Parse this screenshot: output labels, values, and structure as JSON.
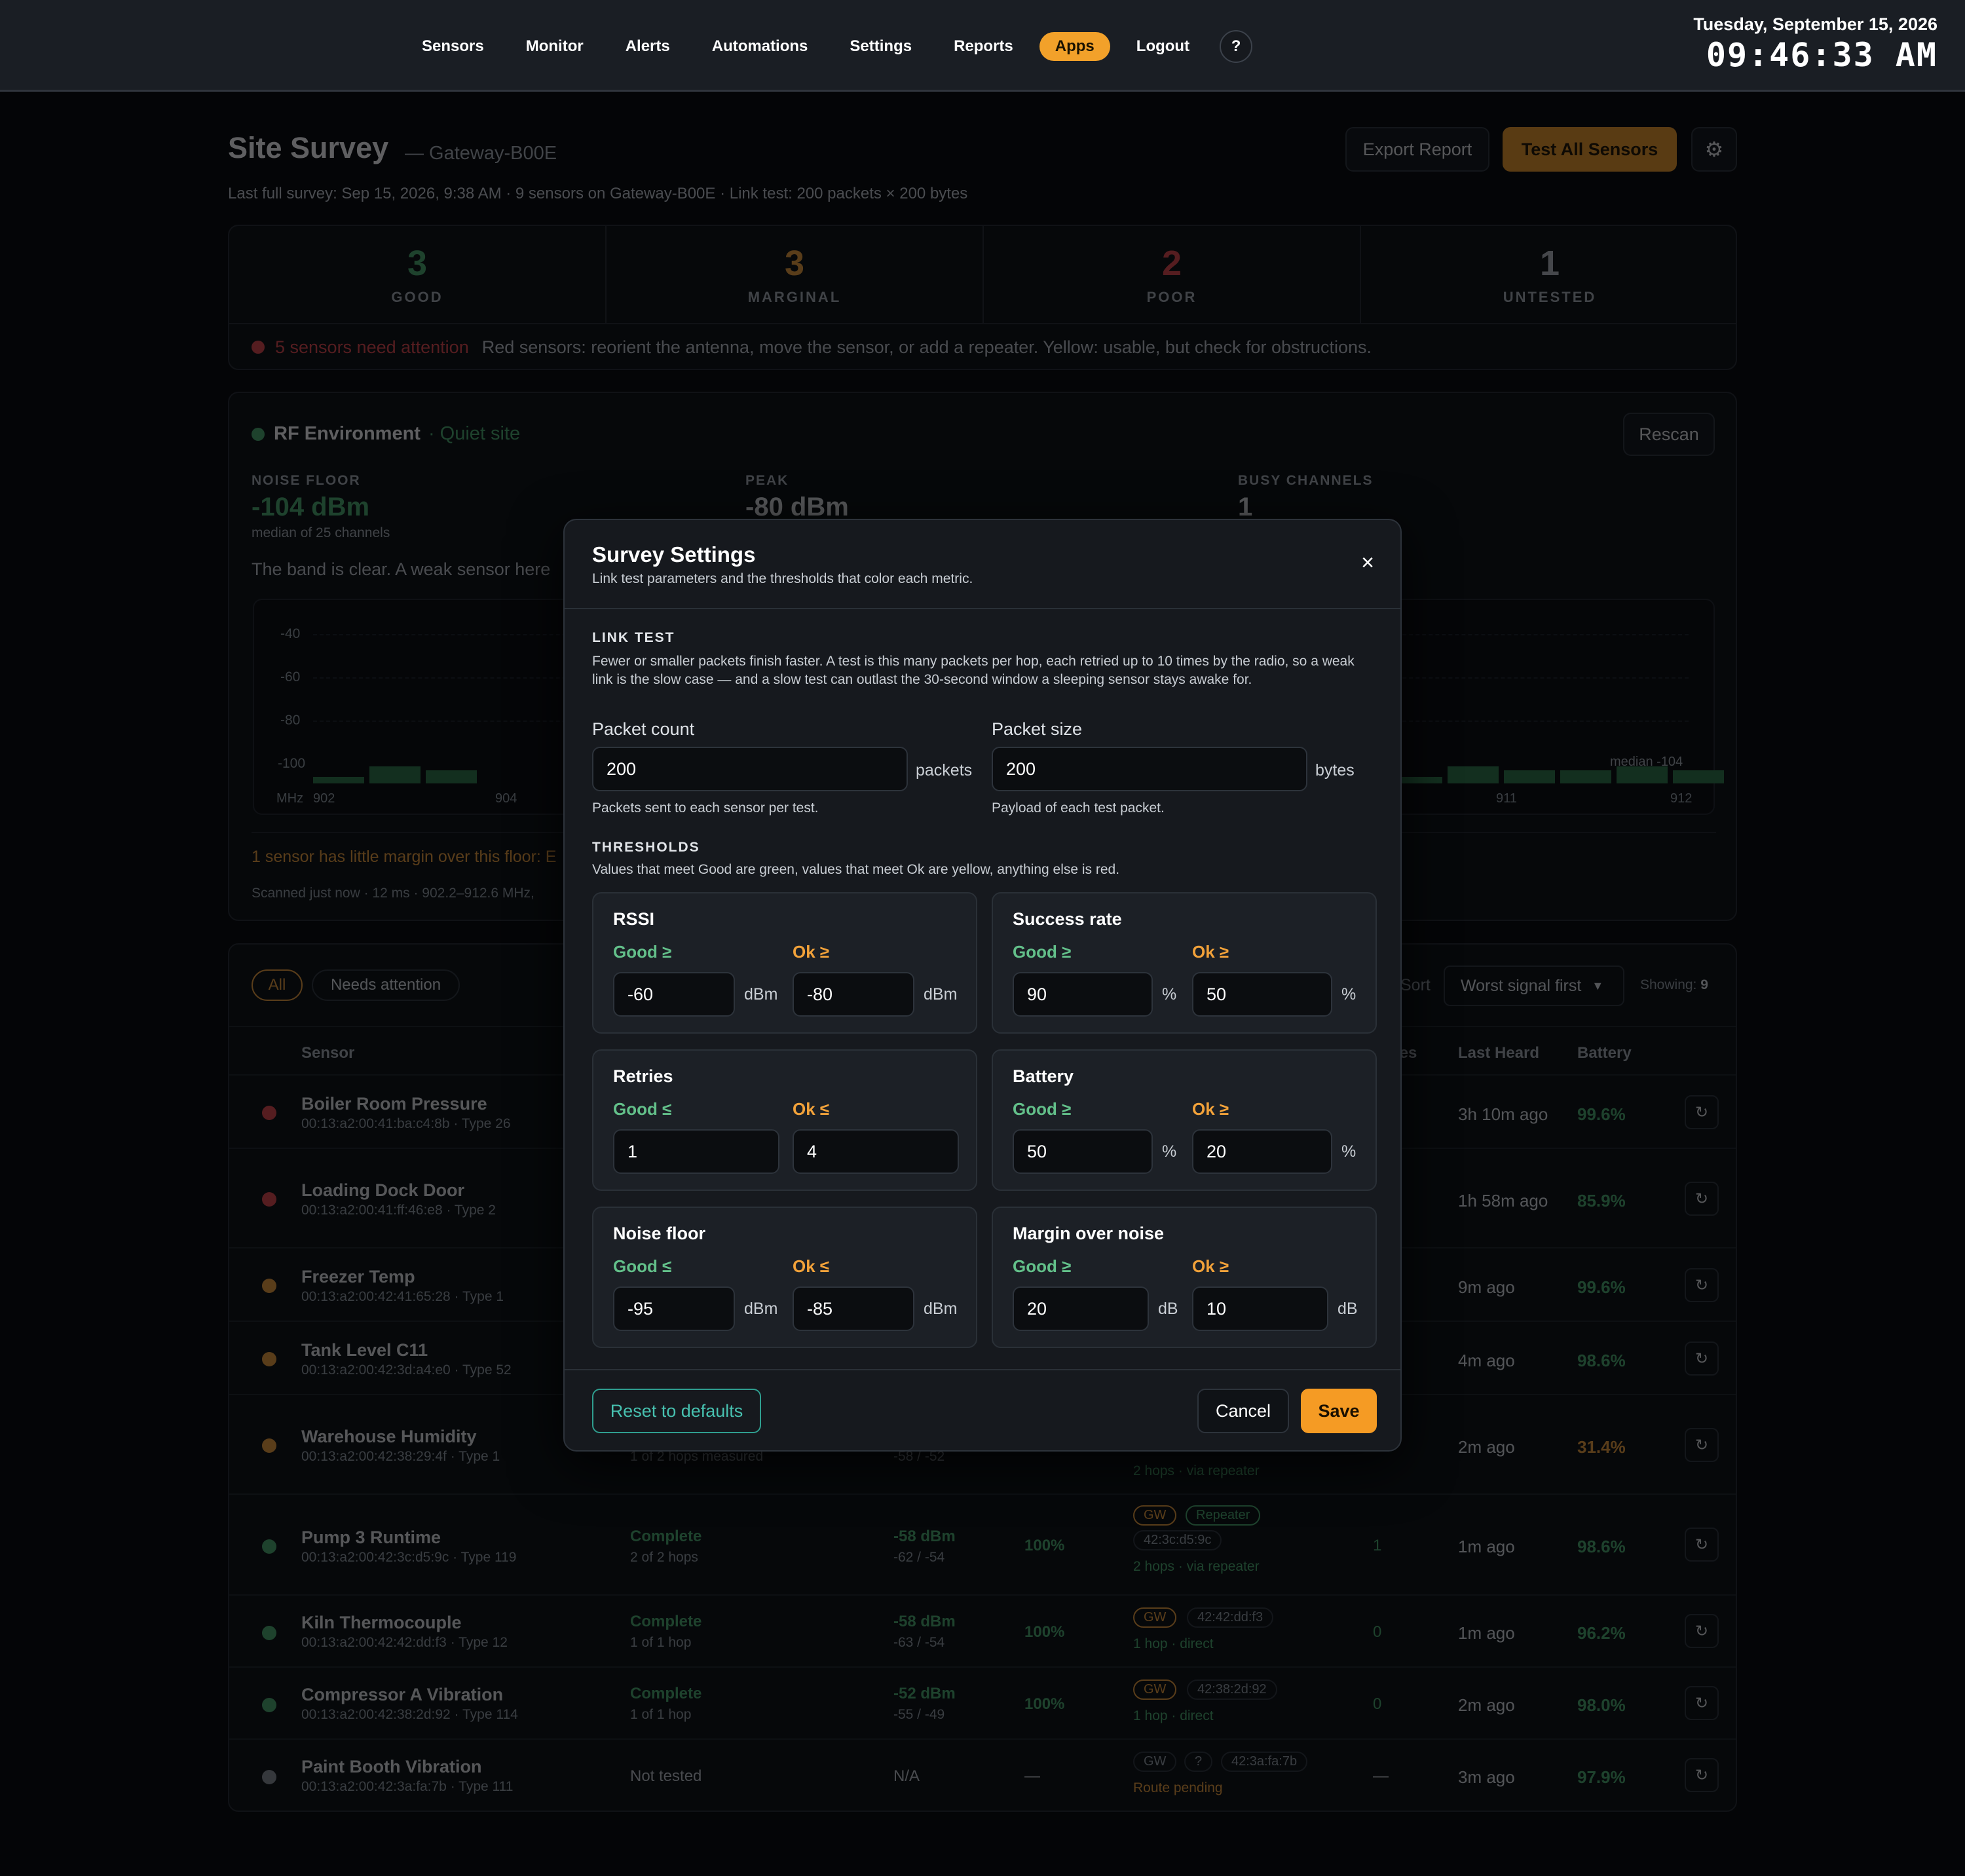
{
  "nav": {
    "items": [
      "Sensors",
      "Monitor",
      "Alerts",
      "Automations",
      "Settings",
      "Reports",
      "Apps",
      "Logout"
    ],
    "active": "Apps",
    "help": "?"
  },
  "clock": {
    "date": "Tuesday, September 15, 2026",
    "time": "09:46:33 AM"
  },
  "page": {
    "title": "Site Survey",
    "gateway": "— Gateway-B00E",
    "meta": "Last full survey: Sep 15, 2026, 9:38 AM · 9 sensors on Gateway-B00E · Link test: 200 packets × 200 bytes",
    "export_label": "Export Report",
    "test_all_label": "Test All Sensors"
  },
  "stats": [
    {
      "value": "3",
      "label": "GOOD",
      "color": "#4caf72"
    },
    {
      "value": "3",
      "label": "MARGINAL",
      "color": "#f0a03c"
    },
    {
      "value": "2",
      "label": "POOR",
      "color": "#e5484d"
    },
    {
      "value": "1",
      "label": "UNTESTED",
      "color": "#b7bcc4"
    }
  ],
  "attention": {
    "count_text": "5 sensors need attention",
    "message": "Red sensors: reorient the antenna, move the sensor, or add a repeater. Yellow: usable, but check for obstructions."
  },
  "rf": {
    "title": "RF Environment",
    "status": "· Quiet site",
    "rescan_label": "Rescan",
    "noise_floor_label": "NOISE FLOOR",
    "noise_floor_value": "-104 dBm",
    "noise_floor_note": "median of 25 channels",
    "peak_label": "PEAK",
    "peak_value": "-80 dBm",
    "busy_label": "BUSY CHANNELS",
    "busy_value": "1",
    "summary": "The band is clear. A weak sensor here",
    "y_ticks": [
      "-40",
      "-60",
      "-80",
      "-100"
    ],
    "x_unit": "MHz",
    "x_ticks_left": [
      "902",
      "904"
    ],
    "x_ticks_right": [
      "911",
      "912"
    ],
    "median_label": "median -104",
    "margin_warning": "1 sensor has little margin over this floor: E",
    "scan_meta": "Scanned just now · 12 ms · 902.2–912.6 MHz, "
  },
  "table": {
    "filters": [
      "All",
      "Needs attention"
    ],
    "sort_label": "Sort",
    "sort_value": "Worst signal first",
    "showing_label": "Showing:",
    "showing_value": "9",
    "headers": {
      "sensor": "Sensor",
      "retries": "ies",
      "last_heard": "Last Heard",
      "battery": "Battery"
    },
    "rows": [
      {
        "name": "Boiler Room Pressure",
        "id": "00:13:a2:00:41:ba:c4:8b · Type 26",
        "status": "red",
        "last": "3h 10m ago",
        "battery": "99.6%",
        "bcolor": "#4caf72"
      },
      {
        "name": "Loading Dock Door",
        "id": "00:13:a2:00:41:ff:46:e8 · Type 2",
        "status": "red",
        "last": "1h 58m ago",
        "battery": "85.9%",
        "bcolor": "#4caf72"
      },
      {
        "name": "Freezer Temp",
        "id": "00:13:a2:00:42:41:65:28 · Type 1",
        "status": "orange",
        "last": "9m ago",
        "battery": "99.6%",
        "bcolor": "#4caf72"
      },
      {
        "name": "Tank Level C11",
        "id": "00:13:a2:00:42:3d:a4:e0 · Type 52",
        "status": "orange",
        "last": "4m ago",
        "battery": "98.6%",
        "bcolor": "#4caf72"
      },
      {
        "name": "Warehouse Humidity",
        "id": "00:13:a2:00:42:38:29:4f · Type 1",
        "status": "orange",
        "last": "2m ago",
        "battery": "31.4%",
        "bcolor": "#f0a03c",
        "partial_hops": "1 of 2 hops measured",
        "partial_rssi": "-58 / -52",
        "route": "2 hops · via repeater"
      },
      {
        "name": "Pump 3 Runtime",
        "id": "00:13:a2:00:42:3c:d5:9c · Type 119",
        "status": "green",
        "result": "Complete",
        "hops": "2 of 2 hops",
        "rssi": "-58 dBm",
        "rssi_range": "-62 / -54",
        "success": "100%",
        "tags": [
          "GW",
          "Repeater"
        ],
        "mac": "42:3c:d5:9c",
        "route": "2 hops · via repeater",
        "retries": "1",
        "last": "1m ago",
        "battery": "98.6%",
        "bcolor": "#4caf72"
      },
      {
        "name": "Kiln Thermocouple",
        "id": "00:13:a2:00:42:42:dd:f3 · Type 12",
        "status": "green",
        "result": "Complete",
        "hops": "1 of 1 hop",
        "rssi": "-58 dBm",
        "rssi_range": "-63 / -54",
        "success": "100%",
        "tags": [
          "GW"
        ],
        "mac": "42:42:dd:f3",
        "route": "1 hop · direct",
        "retries": "0",
        "last": "1m ago",
        "battery": "96.2%",
        "bcolor": "#4caf72"
      },
      {
        "name": "Compressor A Vibration",
        "id": "00:13:a2:00:42:38:2d:92 · Type 114",
        "status": "green",
        "result": "Complete",
        "hops": "1 of 1 hop",
        "rssi": "-52 dBm",
        "rssi_range": "-55 / -49",
        "success": "100%",
        "tags": [
          "GW"
        ],
        "mac": "42:38:2d:92",
        "route": "1 hop · direct",
        "retries": "0",
        "last": "2m ago",
        "battery": "98.0%",
        "bcolor": "#4caf72"
      },
      {
        "name": "Paint Booth Vibration",
        "id": "00:13:a2:00:42:3a:fa:7b · Type 111",
        "status": "grey",
        "result": "Not tested",
        "rssi": "N/A",
        "success": "—",
        "tags": [
          "GW",
          "?"
        ],
        "mac": "42:3a:fa:7b",
        "route": "Route pending",
        "retries": "—",
        "last": "3m ago",
        "battery": "97.9%",
        "bcolor": "#4caf72"
      }
    ]
  },
  "modal": {
    "title": "Survey Settings",
    "subtitle": "Link test parameters and the thresholds that color each metric.",
    "close": "×",
    "link_section": "LINK TEST",
    "link_desc": "Fewer or smaller packets finish faster. A test is this many packets per hop, each retried up to 10 times by the radio, so a weak link is the slow case — and a slow test can outlast the 30-second window a sleeping sensor stays awake for.",
    "packet_count_label": "Packet count",
    "packet_count_value": "200",
    "packet_count_unit": "packets",
    "packet_count_hint": "Packets sent to each sensor per test.",
    "packet_size_label": "Packet size",
    "packet_size_value": "200",
    "packet_size_unit": "bytes",
    "packet_size_hint": "Payload of each test packet.",
    "thresh_section": "THRESHOLDS",
    "thresh_desc": "Values that meet Good are green, values that meet Ok are yellow, anything else is red.",
    "cards": [
      {
        "title": "RSSI",
        "good_label": "Good ≥",
        "ok_label": "Ok ≥",
        "good": "-60",
        "ok": "-80",
        "unit": "dBm"
      },
      {
        "title": "Success rate",
        "good_label": "Good ≥",
        "ok_label": "Ok ≥",
        "good": "90",
        "ok": "50",
        "unit": "%"
      },
      {
        "title": "Retries",
        "good_label": "Good ≤",
        "ok_label": "Ok ≤",
        "good": "1",
        "ok": "4",
        "unit": ""
      },
      {
        "title": "Battery",
        "good_label": "Good ≥",
        "ok_label": "Ok ≥",
        "good": "50",
        "ok": "20",
        "unit": "%"
      },
      {
        "title": "Noise floor",
        "good_label": "Good ≤",
        "ok_label": "Ok ≤",
        "good": "-95",
        "ok": "-85",
        "unit": "dBm"
      },
      {
        "title": "Margin over noise",
        "good_label": "Good ≥",
        "ok_label": "Ok ≥",
        "good": "20",
        "ok": "10",
        "unit": "dB"
      }
    ],
    "reset_label": "Reset to defaults",
    "cancel_label": "Cancel",
    "save_label": "Save"
  }
}
